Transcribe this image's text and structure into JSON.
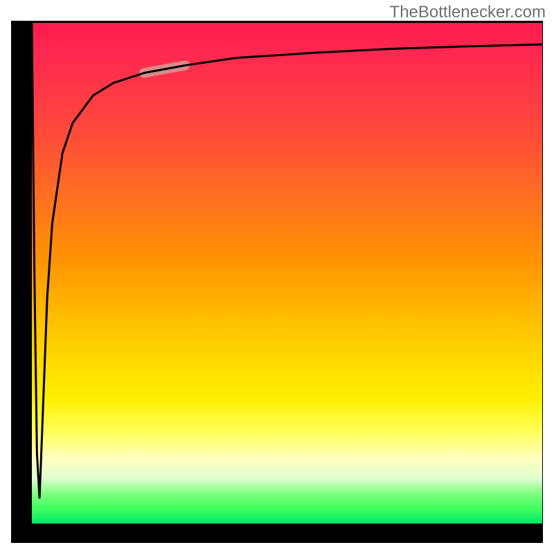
{
  "watermark": "TheBottlenecker.com",
  "chart_data": {
    "type": "line",
    "title": "",
    "xlabel": "",
    "ylabel": "",
    "xlim": [
      0,
      100
    ],
    "ylim": [
      0,
      100
    ],
    "series": [
      {
        "name": "bottleneck-curve",
        "x": [
          0,
          0.5,
          1,
          1.5,
          2,
          3,
          4,
          6,
          8,
          12,
          16,
          22,
          30,
          40,
          55,
          70,
          85,
          100
        ],
        "values": [
          100,
          50,
          14,
          5,
          18,
          45,
          60,
          74,
          80,
          85.5,
          88,
          90,
          91.5,
          93,
          94,
          94.8,
          95.3,
          95.7
        ]
      },
      {
        "name": "highlight-region",
        "x": [
          22,
          30
        ],
        "values": [
          90,
          91.5
        ]
      }
    ],
    "annotations": [],
    "background_gradient": {
      "type": "vertical",
      "stops": [
        {
          "pos": 0.0,
          "color": "#ff1a4d"
        },
        {
          "pos": 0.5,
          "color": "#ff9500"
        },
        {
          "pos": 0.8,
          "color": "#ffff00"
        },
        {
          "pos": 0.92,
          "color": "#e0ffc0"
        },
        {
          "pos": 1.0,
          "color": "#00e868"
        }
      ]
    }
  }
}
